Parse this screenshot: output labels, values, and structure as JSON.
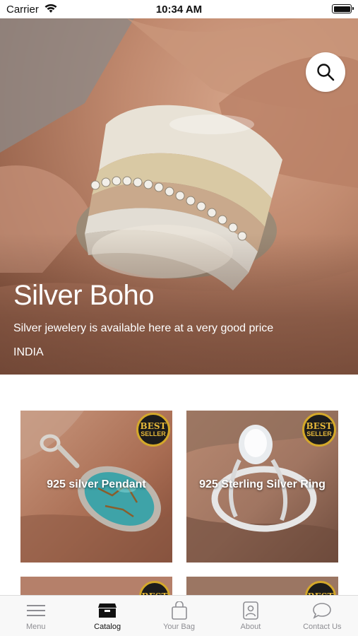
{
  "status_bar": {
    "carrier": "Carrier",
    "time": "10:34 AM"
  },
  "hero": {
    "title": "Silver Boho",
    "subtitle": "Silver jewelery is available here at a very good price",
    "location": "INDIA"
  },
  "search": {
    "icon": "search-icon"
  },
  "products": [
    {
      "label": "925 silver Pendant",
      "badge_top": "BEST",
      "badge_bottom": "SELLER"
    },
    {
      "label": "925 Sterling Silver Ring",
      "badge_top": "BEST",
      "badge_bottom": "SELLER"
    },
    {
      "label": "",
      "badge_top": "BEST",
      "badge_bottom": ""
    },
    {
      "label": "",
      "badge_top": "BEST",
      "badge_bottom": ""
    }
  ],
  "tabs": [
    {
      "label": "Menu",
      "icon": "menu-icon",
      "active": false
    },
    {
      "label": "Catalog",
      "icon": "catalog-icon",
      "active": true
    },
    {
      "label": "Your Bag",
      "icon": "bag-icon",
      "active": false
    },
    {
      "label": "About",
      "icon": "about-icon",
      "active": false
    },
    {
      "label": "Contact Us",
      "icon": "chat-icon",
      "active": false
    }
  ],
  "colors": {
    "badge_gold": "#e7b93a",
    "active_tab": "#111111",
    "inactive_tab": "#8e8e93"
  }
}
